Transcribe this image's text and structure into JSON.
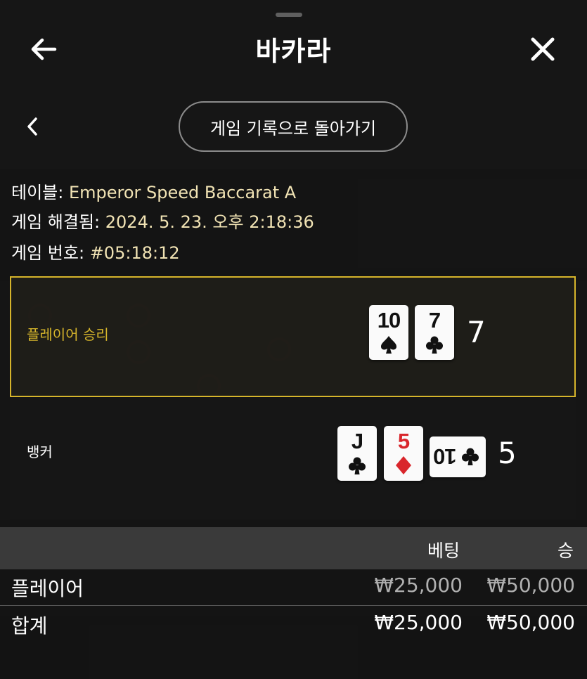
{
  "header": {
    "title": "바카라"
  },
  "history_button": {
    "label": "게임 기록으로 돌아가기"
  },
  "info": {
    "table_label": "테이블:",
    "table_value": "Emperor Speed Baccarat A",
    "resolved_label": "게임 해결됨:",
    "resolved_value": "2024. 5. 23. 오후 2:18:36",
    "game_no_label": "게임 번호:",
    "game_no_value": "#05:18:12"
  },
  "player": {
    "label": "플레이어 승리",
    "total": "7",
    "cards": [
      {
        "rank": "10",
        "suit": "spade-icon"
      },
      {
        "rank": "7",
        "suit": "club-icon"
      }
    ]
  },
  "banker": {
    "label": "뱅커",
    "total": "5",
    "cards": [
      {
        "rank": "J",
        "suit": "club-icon"
      },
      {
        "rank": "5",
        "suit": "diamond-icon"
      },
      {
        "rank": "10",
        "suit": "club-icon"
      }
    ]
  },
  "bets_table": {
    "headers": {
      "bet": "베팅",
      "win": "승"
    },
    "rows": [
      {
        "name": "플레이어",
        "bet": "₩25,000",
        "win": "₩50,000"
      }
    ],
    "total": {
      "name": "합계",
      "bet": "₩25,000",
      "win": "₩50,000"
    }
  },
  "colors": {
    "accent_gold": "#d6b52b",
    "info_value": "#f1e3b4",
    "red_suit": "#d9262c"
  }
}
